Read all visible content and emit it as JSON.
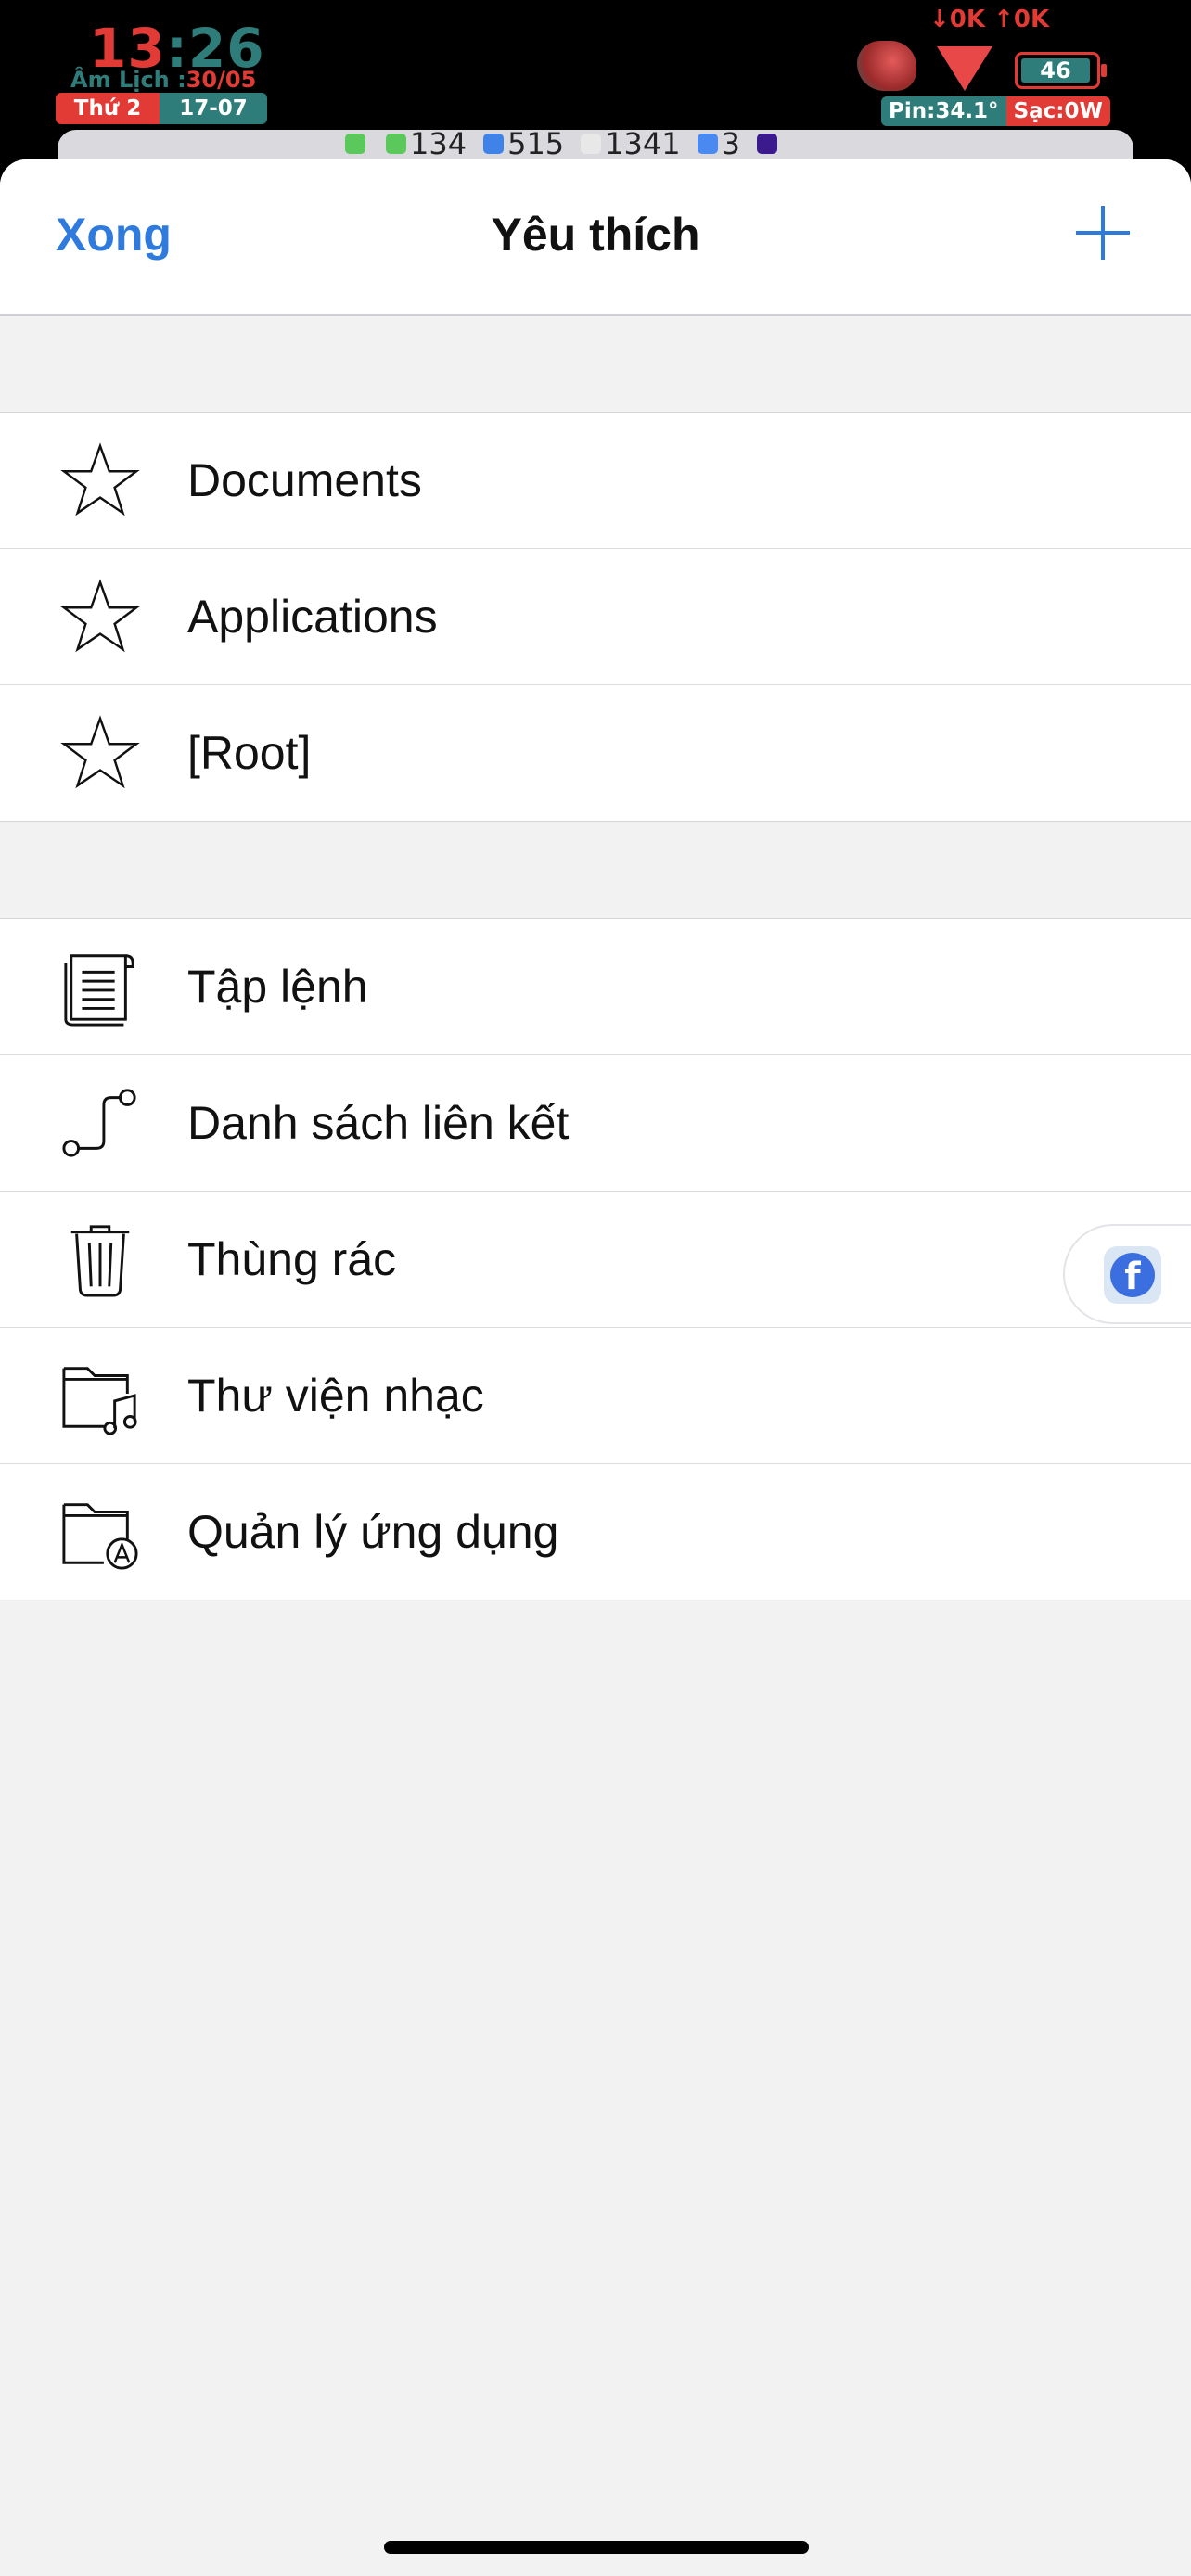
{
  "status_bar": {
    "time_hour": "13",
    "time_minute": "26",
    "lunar_label": "Âm Lịch :",
    "lunar_date": "30/05",
    "weekday": "Thứ 2",
    "date": "17-07",
    "net_speed": "↓0K ↑0K",
    "battery_level": "46",
    "battery_temp": "Pin:34.1°",
    "charge_rate": "Sạc:0W",
    "badges": [
      {
        "icon": "phone-icon",
        "color": "#5ac85a",
        "count": ""
      },
      {
        "icon": "messages-icon",
        "color": "#5ac85a",
        "count": "134"
      },
      {
        "icon": "zalo-icon",
        "color": "#3f82e8",
        "count": "515"
      },
      {
        "icon": "gmail-icon",
        "color": "#e8e8e8",
        "count": "1341"
      },
      {
        "icon": "messenger-icon",
        "color": "#4a8af0",
        "count": "3"
      },
      {
        "icon": "app-icon",
        "color": "#3a1a8c",
        "count": ""
      }
    ]
  },
  "nav": {
    "done_label": "Xong",
    "title": "Yêu thích",
    "add_icon": "plus-icon"
  },
  "favorites": [
    {
      "label": "Documents",
      "icon": "star-icon"
    },
    {
      "label": "Applications",
      "icon": "star-icon"
    },
    {
      "label": "[Root]",
      "icon": "star-icon"
    }
  ],
  "tools": [
    {
      "label": "Tập lệnh",
      "icon": "script-icon"
    },
    {
      "label": "Danh sách liên kết",
      "icon": "link-list-icon"
    },
    {
      "label": "Thùng rác",
      "icon": "trash-icon"
    },
    {
      "label": "Thư viện nhạc",
      "icon": "music-folder-icon"
    },
    {
      "label": "Quản lý ứng dụng",
      "icon": "app-folder-icon"
    }
  ],
  "floating": {
    "icon": "facebook-icon",
    "glyph": "f"
  },
  "colors": {
    "accent": "#2f7bdd",
    "status_red": "#e23a34",
    "status_teal": "#2f7d7a"
  }
}
